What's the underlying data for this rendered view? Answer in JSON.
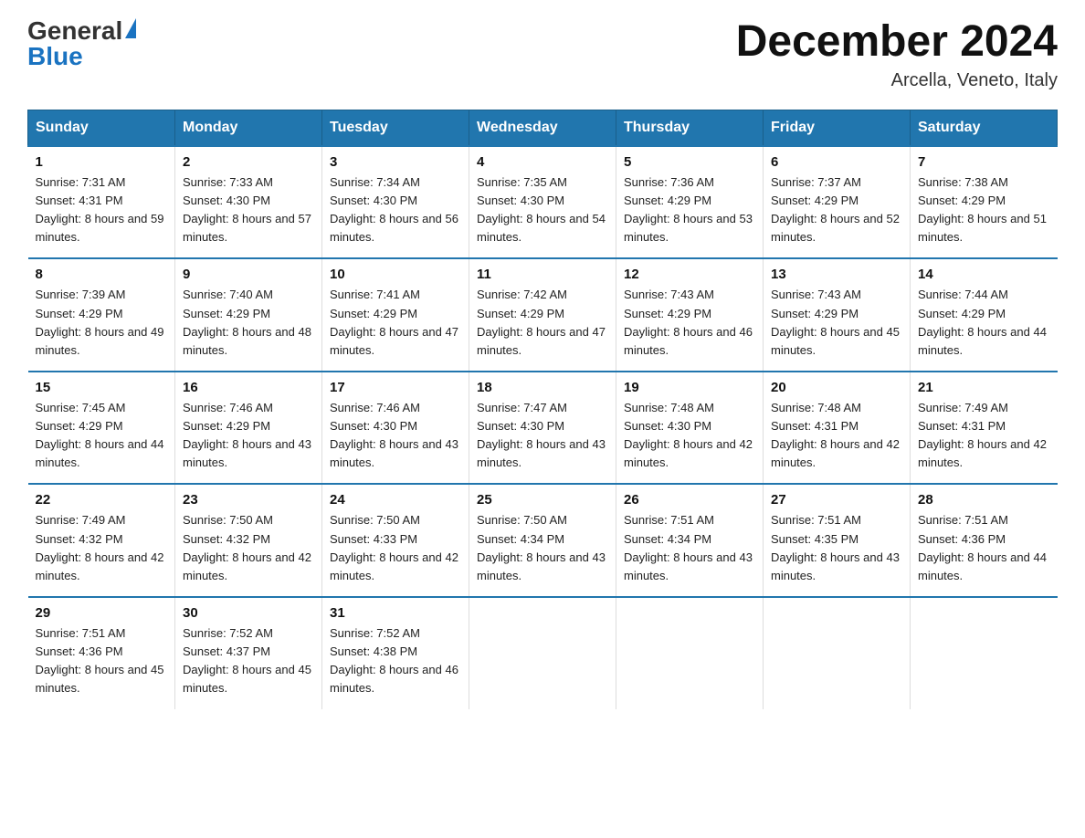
{
  "header": {
    "logo_general": "General",
    "logo_blue": "Blue",
    "month_title": "December 2024",
    "location": "Arcella, Veneto, Italy"
  },
  "days_of_week": [
    "Sunday",
    "Monday",
    "Tuesday",
    "Wednesday",
    "Thursday",
    "Friday",
    "Saturday"
  ],
  "weeks": [
    [
      {
        "day": "1",
        "sunrise": "7:31 AM",
        "sunset": "4:31 PM",
        "daylight": "8 hours and 59 minutes."
      },
      {
        "day": "2",
        "sunrise": "7:33 AM",
        "sunset": "4:30 PM",
        "daylight": "8 hours and 57 minutes."
      },
      {
        "day": "3",
        "sunrise": "7:34 AM",
        "sunset": "4:30 PM",
        "daylight": "8 hours and 56 minutes."
      },
      {
        "day": "4",
        "sunrise": "7:35 AM",
        "sunset": "4:30 PM",
        "daylight": "8 hours and 54 minutes."
      },
      {
        "day": "5",
        "sunrise": "7:36 AM",
        "sunset": "4:29 PM",
        "daylight": "8 hours and 53 minutes."
      },
      {
        "day": "6",
        "sunrise": "7:37 AM",
        "sunset": "4:29 PM",
        "daylight": "8 hours and 52 minutes."
      },
      {
        "day": "7",
        "sunrise": "7:38 AM",
        "sunset": "4:29 PM",
        "daylight": "8 hours and 51 minutes."
      }
    ],
    [
      {
        "day": "8",
        "sunrise": "7:39 AM",
        "sunset": "4:29 PM",
        "daylight": "8 hours and 49 minutes."
      },
      {
        "day": "9",
        "sunrise": "7:40 AM",
        "sunset": "4:29 PM",
        "daylight": "8 hours and 48 minutes."
      },
      {
        "day": "10",
        "sunrise": "7:41 AM",
        "sunset": "4:29 PM",
        "daylight": "8 hours and 47 minutes."
      },
      {
        "day": "11",
        "sunrise": "7:42 AM",
        "sunset": "4:29 PM",
        "daylight": "8 hours and 47 minutes."
      },
      {
        "day": "12",
        "sunrise": "7:43 AM",
        "sunset": "4:29 PM",
        "daylight": "8 hours and 46 minutes."
      },
      {
        "day": "13",
        "sunrise": "7:43 AM",
        "sunset": "4:29 PM",
        "daylight": "8 hours and 45 minutes."
      },
      {
        "day": "14",
        "sunrise": "7:44 AM",
        "sunset": "4:29 PM",
        "daylight": "8 hours and 44 minutes."
      }
    ],
    [
      {
        "day": "15",
        "sunrise": "7:45 AM",
        "sunset": "4:29 PM",
        "daylight": "8 hours and 44 minutes."
      },
      {
        "day": "16",
        "sunrise": "7:46 AM",
        "sunset": "4:29 PM",
        "daylight": "8 hours and 43 minutes."
      },
      {
        "day": "17",
        "sunrise": "7:46 AM",
        "sunset": "4:30 PM",
        "daylight": "8 hours and 43 minutes."
      },
      {
        "day": "18",
        "sunrise": "7:47 AM",
        "sunset": "4:30 PM",
        "daylight": "8 hours and 43 minutes."
      },
      {
        "day": "19",
        "sunrise": "7:48 AM",
        "sunset": "4:30 PM",
        "daylight": "8 hours and 42 minutes."
      },
      {
        "day": "20",
        "sunrise": "7:48 AM",
        "sunset": "4:31 PM",
        "daylight": "8 hours and 42 minutes."
      },
      {
        "day": "21",
        "sunrise": "7:49 AM",
        "sunset": "4:31 PM",
        "daylight": "8 hours and 42 minutes."
      }
    ],
    [
      {
        "day": "22",
        "sunrise": "7:49 AM",
        "sunset": "4:32 PM",
        "daylight": "8 hours and 42 minutes."
      },
      {
        "day": "23",
        "sunrise": "7:50 AM",
        "sunset": "4:32 PM",
        "daylight": "8 hours and 42 minutes."
      },
      {
        "day": "24",
        "sunrise": "7:50 AM",
        "sunset": "4:33 PM",
        "daylight": "8 hours and 42 minutes."
      },
      {
        "day": "25",
        "sunrise": "7:50 AM",
        "sunset": "4:34 PM",
        "daylight": "8 hours and 43 minutes."
      },
      {
        "day": "26",
        "sunrise": "7:51 AM",
        "sunset": "4:34 PM",
        "daylight": "8 hours and 43 minutes."
      },
      {
        "day": "27",
        "sunrise": "7:51 AM",
        "sunset": "4:35 PM",
        "daylight": "8 hours and 43 minutes."
      },
      {
        "day": "28",
        "sunrise": "7:51 AM",
        "sunset": "4:36 PM",
        "daylight": "8 hours and 44 minutes."
      }
    ],
    [
      {
        "day": "29",
        "sunrise": "7:51 AM",
        "sunset": "4:36 PM",
        "daylight": "8 hours and 45 minutes."
      },
      {
        "day": "30",
        "sunrise": "7:52 AM",
        "sunset": "4:37 PM",
        "daylight": "8 hours and 45 minutes."
      },
      {
        "day": "31",
        "sunrise": "7:52 AM",
        "sunset": "4:38 PM",
        "daylight": "8 hours and 46 minutes."
      },
      null,
      null,
      null,
      null
    ]
  ],
  "labels": {
    "sunrise_prefix": "Sunrise: ",
    "sunset_prefix": "Sunset: ",
    "daylight_prefix": "Daylight: "
  }
}
